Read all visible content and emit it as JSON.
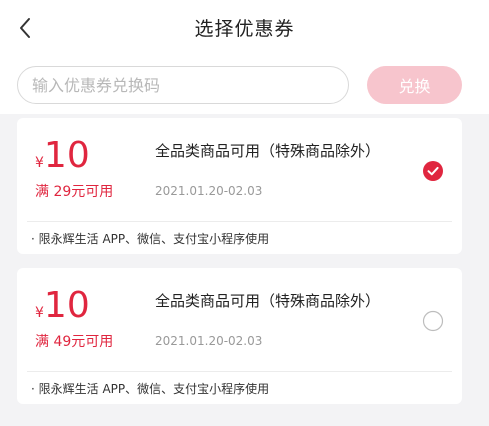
{
  "header": {
    "title": "选择优惠券",
    "back_icon": "chevron-left-icon"
  },
  "redeem": {
    "placeholder": "输入优惠券兑换码",
    "button_label": "兑换"
  },
  "colors": {
    "accent": "#e0263f",
    "button_disabled": "#f7c5cd",
    "background": "#f3f3f5"
  },
  "coupons": [
    {
      "currency": "¥",
      "amount": "10",
      "threshold": "满 29元可用",
      "name": "全品类商品可用（特殊商品除外）",
      "date": "2021.01.20-02.03",
      "note": "· 限永辉生活 APP、微信、支付宝小程序使用",
      "selected": true
    },
    {
      "currency": "¥",
      "amount": "10",
      "threshold": "满 49元可用",
      "name": "全品类商品可用（特殊商品除外）",
      "date": "2021.01.20-02.03",
      "note": "· 限永辉生活 APP、微信、支付宝小程序使用",
      "selected": false
    }
  ]
}
